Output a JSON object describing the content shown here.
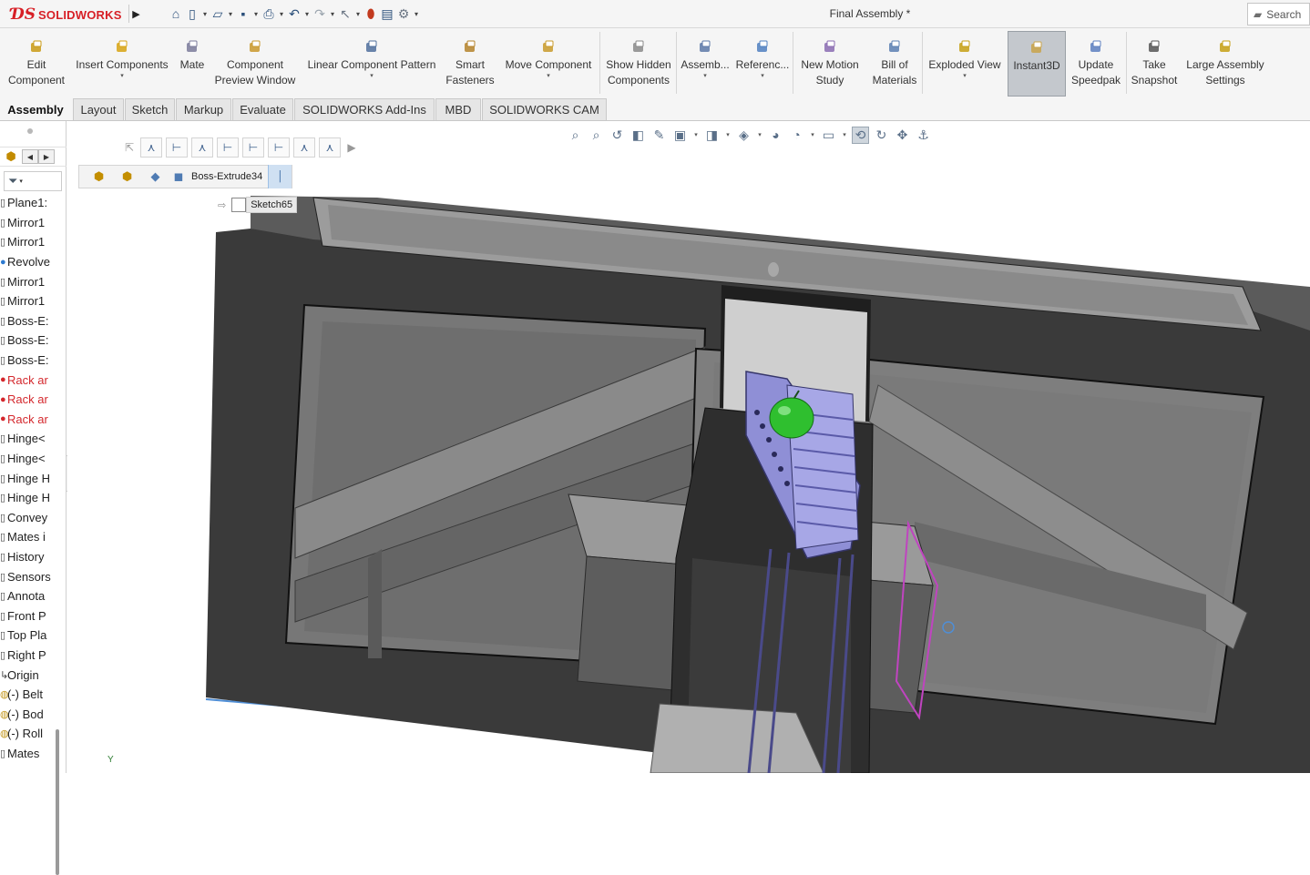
{
  "app": {
    "logo_text": "SOLIDWORKS",
    "document_title": "Final Assembly *",
    "search_label": "Search"
  },
  "quick_access": [
    "home-icon",
    "new-document-icon",
    "open-icon",
    "save-icon",
    "print-icon",
    "undo-icon",
    "redo-icon",
    "select-icon",
    "rebuild-icon",
    "file-properties-icon",
    "options-icon"
  ],
  "command_manager": {
    "items": [
      {
        "label": "Edit\nComponent",
        "icon": "edit-component-icon"
      },
      {
        "label": "Insert Components",
        "icon": "insert-components-icon",
        "dropdown": true
      },
      {
        "label": "Mate",
        "icon": "mate-icon"
      },
      {
        "label": "Component\nPreview Window",
        "icon": "preview-window-icon"
      },
      {
        "label": "Linear Component Pattern",
        "icon": "linear-pattern-icon",
        "dropdown": true
      },
      {
        "label": "Smart\nFasteners",
        "icon": "smart-fasteners-icon"
      },
      {
        "label": "Move Component",
        "icon": "move-component-icon",
        "dropdown": true
      },
      {
        "label": "Show Hidden\nComponents",
        "icon": "show-hidden-icon"
      },
      {
        "label": "Assemb...",
        "icon": "assembly-features-icon",
        "dropdown": true
      },
      {
        "label": "Referenc...",
        "icon": "reference-geometry-icon",
        "dropdown": true
      },
      {
        "label": "New Motion\nStudy",
        "icon": "motion-study-icon"
      },
      {
        "label": "Bill of\nMaterials",
        "icon": "bom-icon"
      },
      {
        "label": "Exploded View",
        "icon": "exploded-view-icon",
        "dropdown": true
      },
      {
        "label": "Instant3D",
        "icon": "instant3d-icon",
        "active": true
      },
      {
        "label": "Update\nSpeedpak",
        "icon": "speedpak-icon"
      },
      {
        "label": "Take\nSnapshot",
        "icon": "snapshot-icon"
      },
      {
        "label": "Large Assembly\nSettings",
        "icon": "large-assembly-icon"
      }
    ]
  },
  "tabs": [
    {
      "label": "Assembly",
      "active": true
    },
    {
      "label": "Layout"
    },
    {
      "label": "Sketch"
    },
    {
      "label": "Markup"
    },
    {
      "label": "Evaluate"
    },
    {
      "label": "SOLIDWORKS Add-Ins"
    },
    {
      "label": "MBD"
    },
    {
      "label": "SOLIDWORKS CAM"
    }
  ],
  "feature_tree": {
    "items": [
      {
        "label": "Plane1:",
        "mark": "plane",
        "color": "normal"
      },
      {
        "label": "Mirror1",
        "mark": "mirror",
        "color": "normal"
      },
      {
        "label": "Mirror1",
        "mark": "mirror",
        "color": "normal"
      },
      {
        "label": "Revolve",
        "mark": "revolve",
        "color": "normal"
      },
      {
        "label": "Mirror1",
        "mark": "mirror",
        "color": "normal"
      },
      {
        "label": "Mirror1",
        "mark": "mirror",
        "color": "normal"
      },
      {
        "label": "Boss-E:",
        "mark": "boss",
        "color": "normal"
      },
      {
        "label": "Boss-E:",
        "mark": "boss",
        "color": "normal"
      },
      {
        "label": "Boss-E:",
        "mark": "boss",
        "color": "normal"
      },
      {
        "label": "Rack ar",
        "mark": "error",
        "color": "red"
      },
      {
        "label": "Rack ar",
        "mark": "error",
        "color": "red"
      },
      {
        "label": "Rack ar",
        "mark": "error",
        "color": "red"
      },
      {
        "label": "Hinge<",
        "mark": "mate",
        "color": "normal"
      },
      {
        "label": "Hinge<",
        "mark": "mate",
        "color": "normal"
      },
      {
        "label": "Hinge H",
        "mark": "mate",
        "color": "normal"
      },
      {
        "label": "Hinge H",
        "mark": "mate",
        "color": "normal"
      },
      {
        "label": "Convey",
        "mark": "mate",
        "color": "normal"
      },
      {
        "label": "Mates i",
        "mark": "mate",
        "color": "normal"
      },
      {
        "label": "History",
        "mark": "history",
        "color": "normal"
      },
      {
        "label": "Sensors",
        "mark": "sensor",
        "color": "normal"
      },
      {
        "label": "Annota",
        "mark": "annotation",
        "color": "normal"
      },
      {
        "label": "Front P",
        "mark": "plane",
        "color": "normal"
      },
      {
        "label": "Top Pla",
        "mark": "plane",
        "color": "normal"
      },
      {
        "label": "Right P",
        "mark": "plane",
        "color": "normal"
      },
      {
        "label": "Origin",
        "mark": "origin",
        "color": "normal"
      },
      {
        "label": "(-) Belt",
        "mark": "part",
        "color": "normal"
      },
      {
        "label": "(-) Bod",
        "mark": "part",
        "color": "normal"
      },
      {
        "label": "(-) Roll",
        "mark": "part",
        "color": "normal"
      },
      {
        "label": "Mates",
        "mark": "mates",
        "color": "normal"
      }
    ]
  },
  "viewport": {
    "breadcrumb_label": "Boss-Extrude34",
    "sketch_label": "Sketch65",
    "triad_label": "Y"
  },
  "colors": {
    "accent": "#d71f26",
    "error_text": "#d4282d",
    "model_dark": "#3c3c3c",
    "conveyor": "#8f8fd6",
    "apple": "#2fbf2f",
    "sketch_magenta": "#c044c0",
    "selection_blue": "#4f8ed6"
  }
}
